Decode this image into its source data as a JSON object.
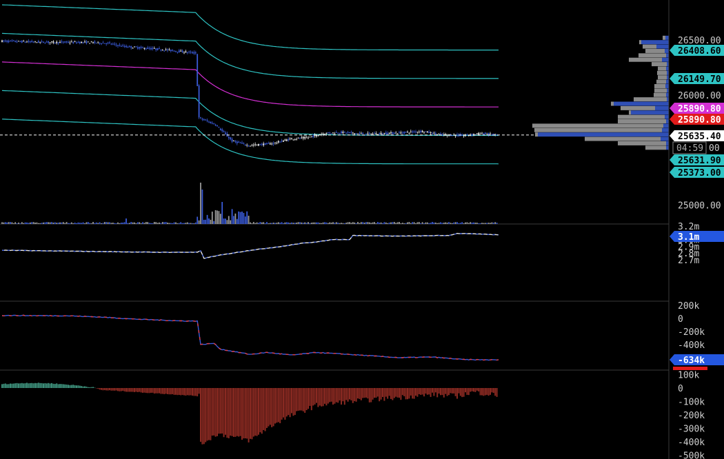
{
  "colors": {
    "background": "#000000",
    "band": "#2ec4c4",
    "vwap": "#d42fd4",
    "candle_up": "#e8e8e8",
    "candle_down": "#3a5bd9",
    "volume_up": "#9a9a9a",
    "volume_down": "#3a5bd9",
    "hist_pos": "#3d8f7a",
    "hist_neg": "#8b2a22",
    "cvd_red": "#e0404a",
    "axis_text": "#cfcfcf",
    "grid": "#2a2a2a"
  },
  "chart_data": [
    {
      "type": "candlestick",
      "panel": "price",
      "yaxis_ticks": [
        {
          "value": 26500,
          "label": "26500.00"
        },
        {
          "value": 26000,
          "label": "26000.00"
        },
        {
          "value": 25000,
          "label": "25000.00"
        }
      ],
      "price_tags": [
        {
          "value": 26408.6,
          "label": "26408.60",
          "color": "#2ec4c4"
        },
        {
          "value": 26149.7,
          "label": "26149.70",
          "color": "#2ec4c4"
        },
        {
          "value": 25890.8,
          "label": "25890.80",
          "color": "#d42fd4"
        },
        {
          "value": 25890.8,
          "label": "25890.80",
          "color": "#e01b1b"
        },
        {
          "value": 25635.4,
          "label": "25635.40",
          "color": "#ffffff"
        },
        {
          "value": 25631.9,
          "label": "25631.90",
          "color": "#2ec4c4"
        },
        {
          "value": 25373.0,
          "label": "25373.00",
          "color": "#2ec4c4"
        }
      ],
      "countdown": "04:59",
      "countdown_suffix": "00",
      "series": [
        {
          "name": "upper band 2",
          "start": 26820,
          "end": 26408.6
        },
        {
          "name": "upper band 1",
          "start": 26560,
          "end": 26149.7
        },
        {
          "name": "vwap",
          "start": 26300,
          "end": 25890.8
        },
        {
          "name": "lower band 1",
          "start": 26040,
          "end": 25631.9
        },
        {
          "name": "lower band 2",
          "start": 25780,
          "end": 25373.0
        }
      ],
      "last_price": 25635.4,
      "volume_profile": [
        {
          "price": 26520,
          "buy": 5,
          "sell": 4
        },
        {
          "price": 26480,
          "buy": 40,
          "sell": 3
        },
        {
          "price": 26440,
          "buy": 18,
          "sell": 20
        },
        {
          "price": 26400,
          "buy": 6,
          "sell": 28
        },
        {
          "price": 26360,
          "buy": 4,
          "sell": 40
        },
        {
          "price": 26320,
          "buy": 10,
          "sell": 48
        },
        {
          "price": 26280,
          "buy": 3,
          "sell": 22
        },
        {
          "price": 26240,
          "buy": 4,
          "sell": 12
        },
        {
          "price": 26200,
          "buy": 3,
          "sell": 14
        },
        {
          "price": 26160,
          "buy": 3,
          "sell": 13
        },
        {
          "price": 26120,
          "buy": 4,
          "sell": 14
        },
        {
          "price": 26080,
          "buy": 5,
          "sell": 16
        },
        {
          "price": 26040,
          "buy": 3,
          "sell": 18
        },
        {
          "price": 26000,
          "buy": 4,
          "sell": 18
        },
        {
          "price": 25960,
          "buy": 3,
          "sell": 48
        },
        {
          "price": 25920,
          "buy": 80,
          "sell": 4
        },
        {
          "price": 25880,
          "buy": 20,
          "sell": 50
        },
        {
          "price": 25840,
          "buy": 55,
          "sell": 3
        },
        {
          "price": 25800,
          "buy": 6,
          "sell": 68
        },
        {
          "price": 25760,
          "buy": 4,
          "sell": 70
        },
        {
          "price": 25720,
          "buy": 8,
          "sell": 190
        },
        {
          "price": 25680,
          "buy": 10,
          "sell": 185
        },
        {
          "price": 25640,
          "buy": 190,
          "sell": 4
        },
        {
          "price": 25600,
          "buy": 12,
          "sell": 110
        },
        {
          "price": 25560,
          "buy": 4,
          "sell": 70
        },
        {
          "price": 25520,
          "buy": 4,
          "sell": 30
        }
      ]
    },
    {
      "type": "line",
      "panel": "indicator1",
      "yaxis_ticks": [
        {
          "value": 3.2,
          "label": "3.2m"
        },
        {
          "value": 3.0,
          "label": "3.0m"
        },
        {
          "value": 2.9,
          "label": "2.9m"
        },
        {
          "value": 2.8,
          "label": "2.8m"
        },
        {
          "value": 2.7,
          "label": "2.7m"
        }
      ],
      "last_value_label": "3.1m",
      "anchors": [
        [
          0,
          2.84
        ],
        [
          30,
          2.83
        ],
        [
          60,
          2.82
        ],
        [
          95,
          2.81
        ],
        [
          118,
          2.81
        ],
        [
          120,
          2.83
        ],
        [
          122,
          2.72
        ],
        [
          130,
          2.76
        ],
        [
          150,
          2.84
        ],
        [
          170,
          2.9
        ],
        [
          175,
          2.92
        ],
        [
          180,
          2.94
        ],
        [
          192,
          2.97
        ],
        [
          200,
          3.0
        ],
        [
          210,
          3.0
        ],
        [
          212,
          3.06
        ],
        [
          240,
          3.05
        ],
        [
          270,
          3.06
        ],
        [
          275,
          3.09
        ],
        [
          290,
          3.08
        ],
        [
          300,
          3.07
        ]
      ]
    },
    {
      "type": "line",
      "panel": "indicator2",
      "yaxis_ticks": [
        {
          "value": 200,
          "label": "200k"
        },
        {
          "value": 0,
          "label": "0"
        },
        {
          "value": -200,
          "label": "-200k"
        },
        {
          "value": -400,
          "label": "-400k"
        }
      ],
      "last_value_label": "-634k",
      "second_value_label": "-634k",
      "anchors": [
        [
          0,
          45
        ],
        [
          40,
          40
        ],
        [
          60,
          20
        ],
        [
          80,
          -10
        ],
        [
          110,
          -40
        ],
        [
          118,
          -40
        ],
        [
          120,
          -400
        ],
        [
          128,
          -380
        ],
        [
          132,
          -470
        ],
        [
          150,
          -550
        ],
        [
          160,
          -520
        ],
        [
          175,
          -560
        ],
        [
          190,
          -520
        ],
        [
          210,
          -550
        ],
        [
          240,
          -600
        ],
        [
          260,
          -590
        ],
        [
          280,
          -630
        ],
        [
          300,
          -634
        ]
      ]
    },
    {
      "type": "bar",
      "panel": "indicator3",
      "yaxis_ticks": [
        {
          "value": 100,
          "label": "100k"
        },
        {
          "value": 0,
          "label": "0"
        },
        {
          "value": -100,
          "label": "-100k"
        },
        {
          "value": -200,
          "label": "-200k"
        },
        {
          "value": -300,
          "label": "-300k"
        },
        {
          "value": -400,
          "label": "-400k"
        },
        {
          "value": -500,
          "label": "-500k"
        }
      ],
      "anchors": [
        [
          0,
          30
        ],
        [
          15,
          38
        ],
        [
          30,
          35
        ],
        [
          45,
          20
        ],
        [
          55,
          5
        ],
        [
          60,
          -15
        ],
        [
          75,
          -25
        ],
        [
          100,
          -45
        ],
        [
          119,
          -60
        ],
        [
          120,
          -420
        ],
        [
          130,
          -340
        ],
        [
          150,
          -390
        ],
        [
          160,
          -300
        ],
        [
          170,
          -230
        ],
        [
          180,
          -180
        ],
        [
          190,
          -130
        ],
        [
          210,
          -100
        ],
        [
          230,
          -80
        ],
        [
          260,
          -50
        ],
        [
          275,
          -60
        ],
        [
          285,
          -30
        ],
        [
          300,
          -55
        ]
      ]
    }
  ]
}
